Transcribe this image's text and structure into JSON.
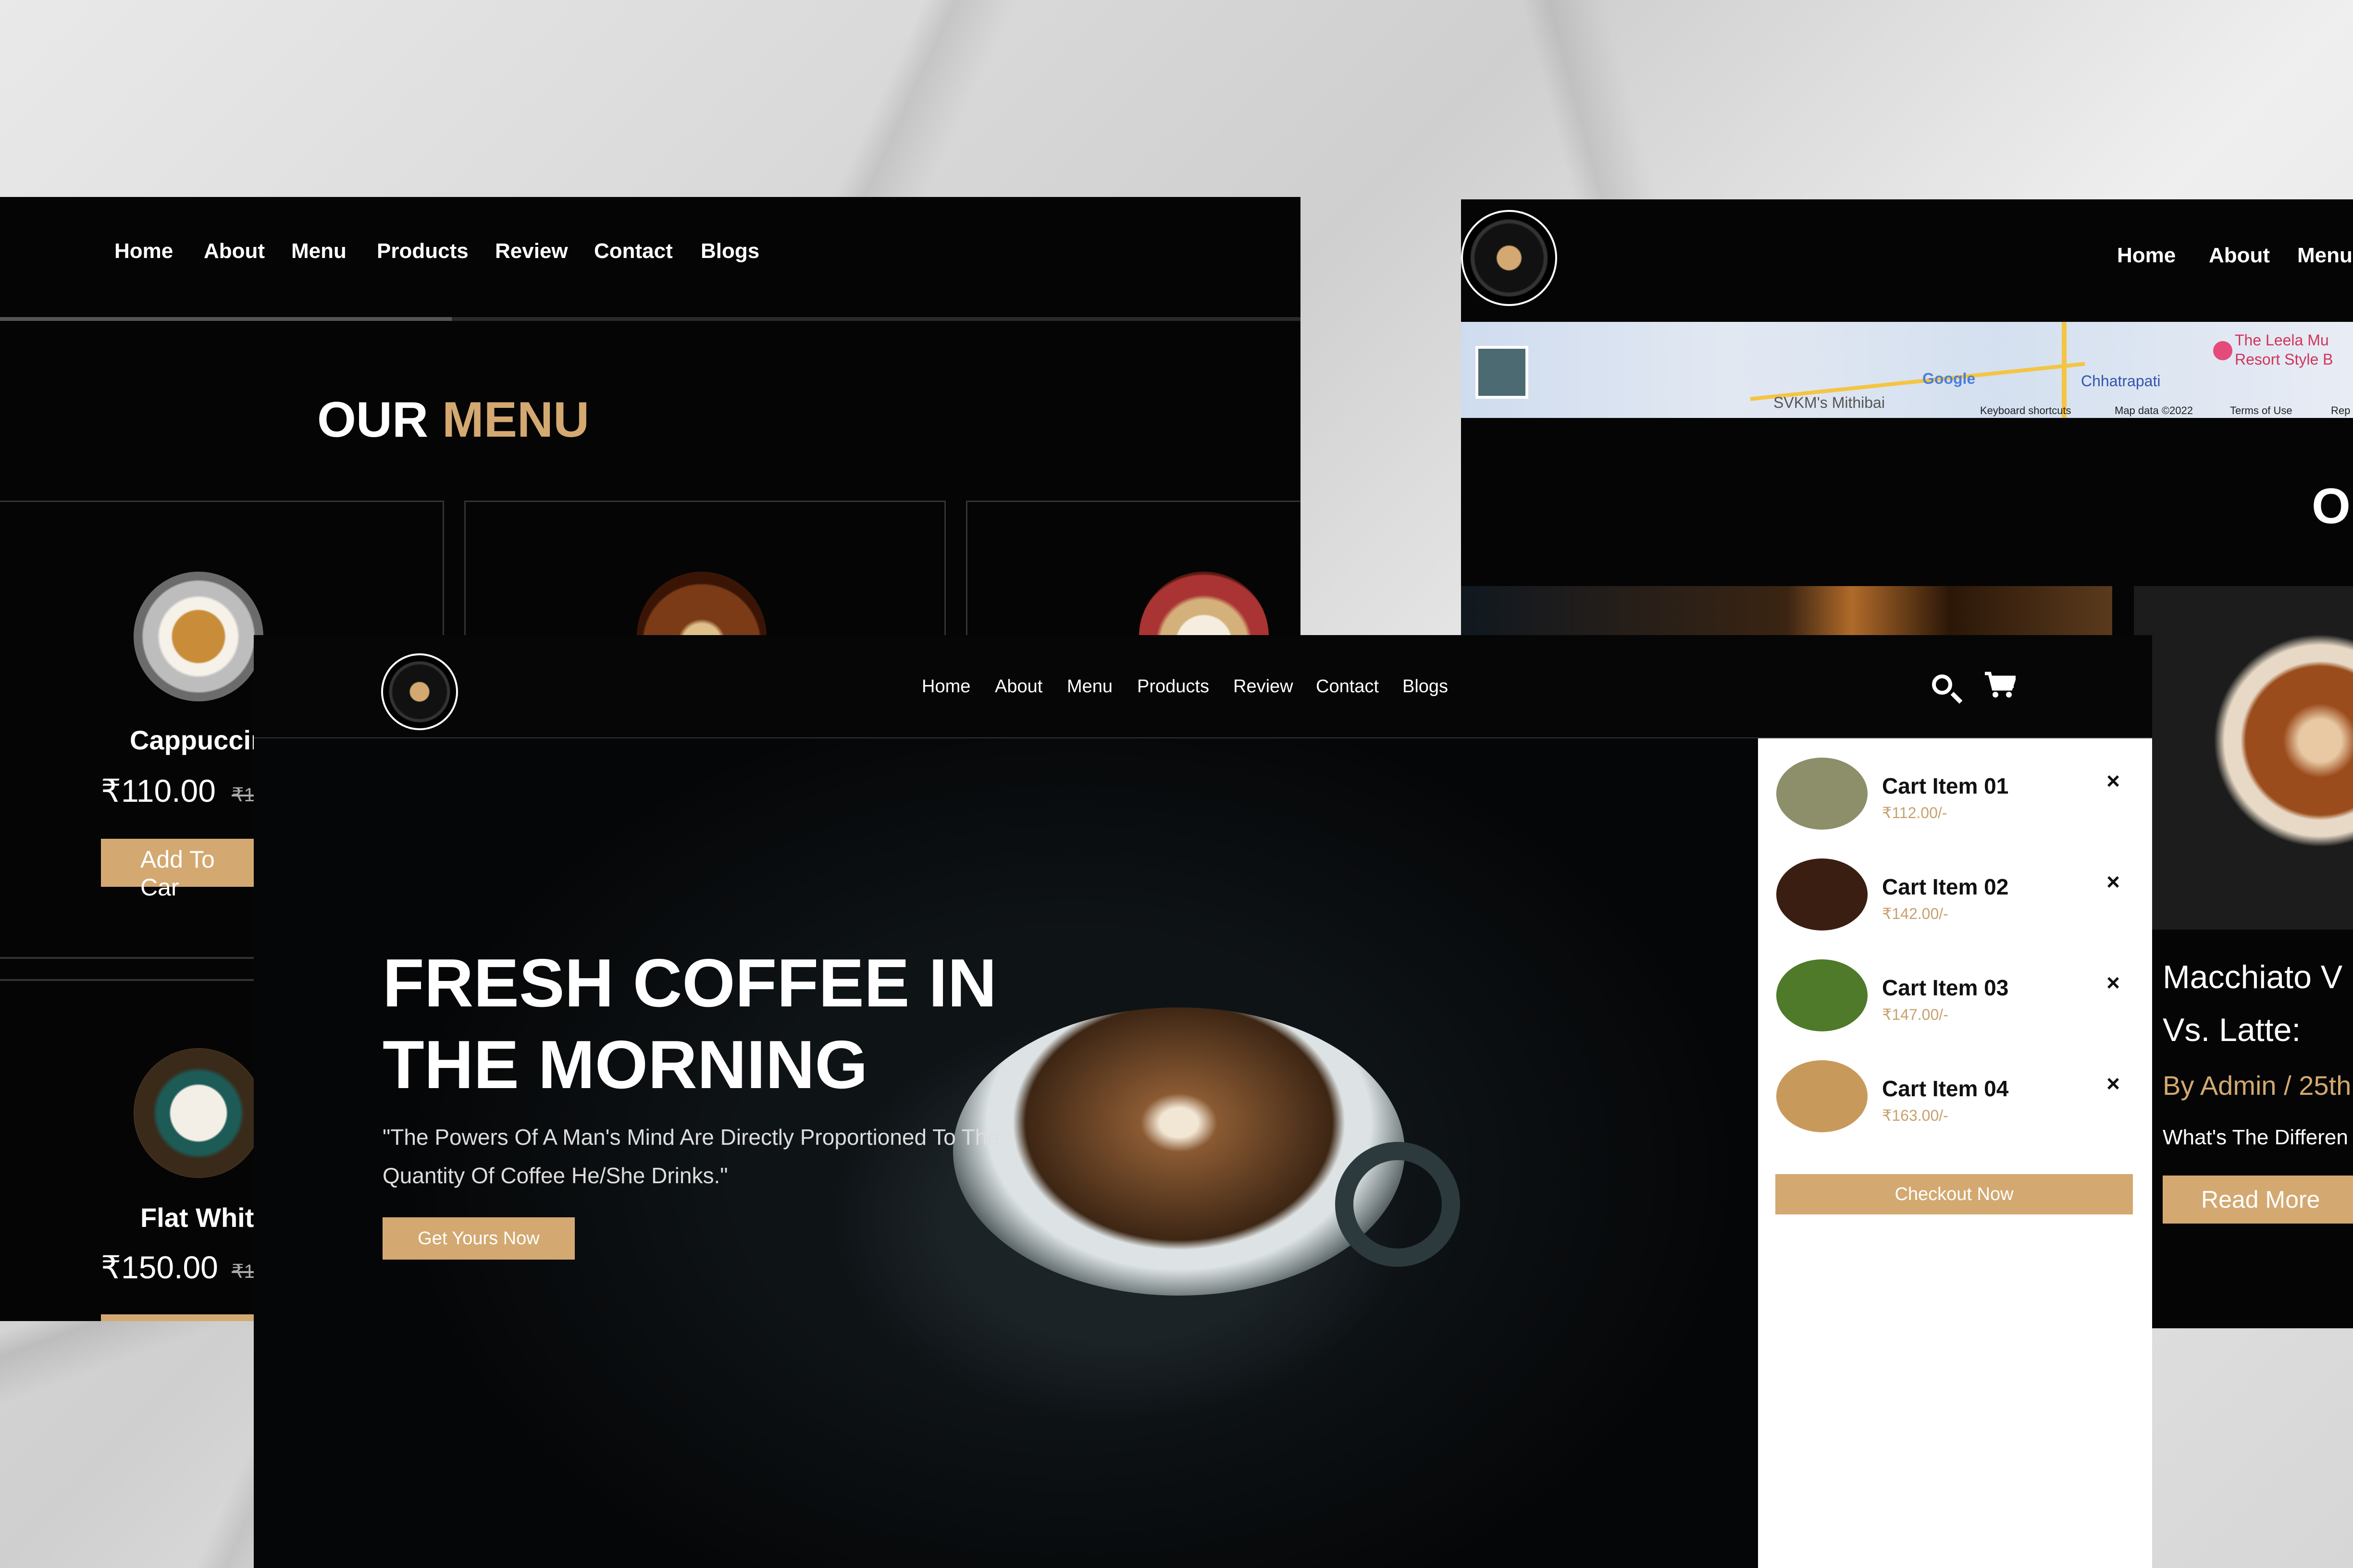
{
  "menu_page": {
    "nav": [
      "Home",
      "About",
      "Menu",
      "Products",
      "Review",
      "Contact",
      "Blogs"
    ],
    "title_main": "OUR",
    "title_accent": "MENU",
    "items": [
      {
        "name": "Cappuccir",
        "price": "₹110.00",
        "old_price": "₹1",
        "button": "Add To Car"
      },
      {
        "name": "Flat Whit",
        "price": "₹150.00",
        "old_price": "₹1"
      }
    ]
  },
  "blog_page": {
    "nav": [
      "Home",
      "About",
      "Menu"
    ],
    "section_letter": "O",
    "map": {
      "label_1": "Google",
      "label_2": "Chhatrapati",
      "label_3": "SVKM's Mithibai",
      "label_4": "The Leela Mu",
      "label_5": "Resort Style B",
      "footer_1": "Keyboard shortcuts",
      "footer_2": "Map data ©2022",
      "footer_3": "Terms of Use",
      "footer_4": "Rep"
    },
    "post": {
      "title_line1": "Macchiato V",
      "title_line2": "Vs. Latte:",
      "byline": "By Admin / 25th",
      "excerpt": "What's The Differen",
      "button": "Read More"
    }
  },
  "hero_page": {
    "nav": [
      "Home",
      "About",
      "Menu",
      "Products",
      "Review",
      "Contact",
      "Blogs"
    ],
    "title": "FRESH COFFEE IN THE MORNING",
    "quote": "\"The Powers Of A Man's Mind Are Directly Proportioned To The Quantity Of Coffee He/She Drinks.\"",
    "cta": "Get Yours Now",
    "cart": {
      "items": [
        {
          "name": "Cart Item 01",
          "price": "₹112.00/-",
          "thumb_color": "#8c8f6a"
        },
        {
          "name": "Cart Item 02",
          "price": "₹142.00/-",
          "thumb_color": "#3b1e12"
        },
        {
          "name": "Cart Item 03",
          "price": "₹147.00/-",
          "thumb_color": "#4e7a2a"
        },
        {
          "name": "Cart Item 04",
          "price": "₹163.00/-",
          "thumb_color": "#c79a5c"
        }
      ],
      "remove_icon": "×",
      "checkout": "Checkout Now"
    }
  },
  "colors": {
    "accent": "#d3a971",
    "background": "#050505"
  }
}
